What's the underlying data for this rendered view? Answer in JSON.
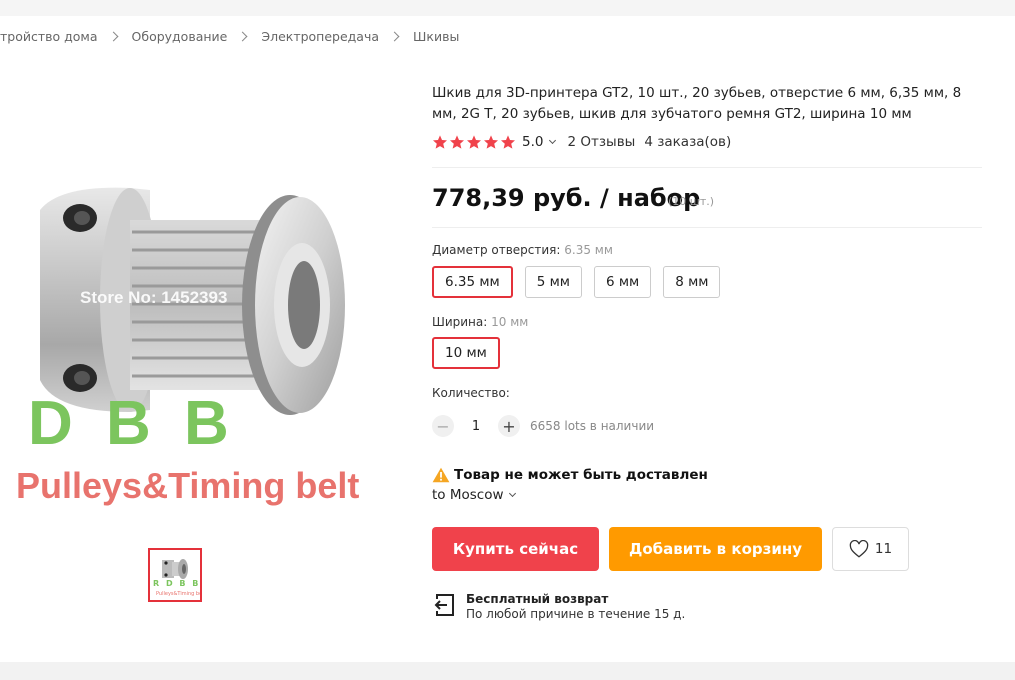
{
  "breadcrumb": [
    "тройство дома",
    "Оборудование",
    "Электропередача",
    "Шкивы"
  ],
  "gallery": {
    "watermark": "Store No: 1452393",
    "brand": "D B B",
    "thumb_brand": "R D B B",
    "caption": "Pulleys&Timing belt"
  },
  "product": {
    "title": "Шкив для 3D-принтера GT2, 10 шт., 20 зубьев, отверстие 6 мм, 6,35 мм, 8 мм, 2G T, 20 зубьев, шкив для зубчатого ремня GT2, ширина 10 мм",
    "rating": "5.0",
    "stars": 5,
    "reviews": "2 Отзывы",
    "orders": "4 заказа(ов)",
    "price": "778,39 руб. / набор",
    "price_note": "(10 шт.)"
  },
  "options": {
    "bore_label": "Диаметр отверстия:",
    "bore_selected": "6.35 мм",
    "bore": [
      "6.35 мм",
      "5 мм",
      "6 мм",
      "8 мм"
    ],
    "width_label": "Ширина:",
    "width_selected": "10 мм",
    "width": [
      "10 мм"
    ]
  },
  "quantity": {
    "label": "Количество:",
    "minus": "−",
    "value": "1",
    "plus": "+",
    "stock": "6658 lots в наличии"
  },
  "shipping": {
    "warning": "Товар не может быть доставлен",
    "to": "to Moscow"
  },
  "actions": {
    "buy": "Купить сейчас",
    "cart": "Добавить в корзину",
    "wish_count": "11"
  },
  "return_policy": {
    "title": "Бесплатный возврат",
    "text": "По любой причине в течение 15 д."
  },
  "colors": {
    "accent_red": "#f0424b",
    "accent_orange": "#ff9a00",
    "star": "#f0424b"
  }
}
